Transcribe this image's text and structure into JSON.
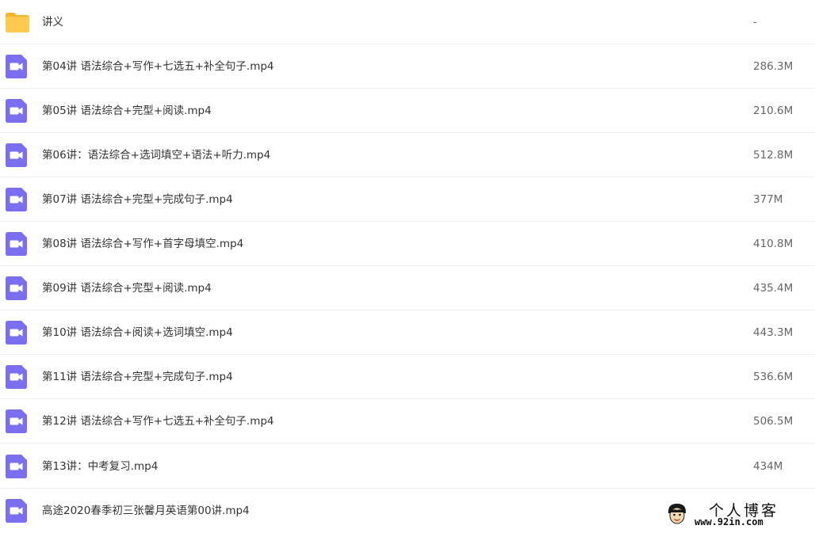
{
  "files": [
    {
      "type": "folder",
      "icon": "folder-icon",
      "name": "讲义",
      "size": "-"
    },
    {
      "type": "video",
      "icon": "video-file-icon",
      "name": "第04讲 语法综合+写作+七选五+补全句子.mp4",
      "size": "286.3M"
    },
    {
      "type": "video",
      "icon": "video-file-icon",
      "name": "第05讲 语法综合+完型+阅读.mp4",
      "size": "210.6M"
    },
    {
      "type": "video",
      "icon": "video-file-icon",
      "name": "第06讲：语法综合+选词填空+语法+听力.mp4",
      "size": "512.8M"
    },
    {
      "type": "video",
      "icon": "video-file-icon",
      "name": "第07讲 语法综合+完型+完成句子.mp4",
      "size": "377M"
    },
    {
      "type": "video",
      "icon": "video-file-icon",
      "name": "第08讲 语法综合+写作+首字母填空.mp4",
      "size": "410.8M"
    },
    {
      "type": "video",
      "icon": "video-file-icon",
      "name": "第09讲 语法综合+完型+阅读.mp4",
      "size": "435.4M"
    },
    {
      "type": "video",
      "icon": "video-file-icon",
      "name": "第10讲 语法综合+阅读+选词填空.mp4",
      "size": "443.3M"
    },
    {
      "type": "video",
      "icon": "video-file-icon",
      "name": "第11讲 语法综合+完型+完成句子.mp4",
      "size": "536.6M"
    },
    {
      "type": "video",
      "icon": "video-file-icon",
      "name": "第12讲 语法综合+写作+七选五+补全句子.mp4",
      "size": "506.5M"
    },
    {
      "type": "video",
      "icon": "video-file-icon",
      "name": "第13讲：中考复习.mp4",
      "size": "434M"
    },
    {
      "type": "video",
      "icon": "video-file-icon",
      "name": "高途2020春季初三张馨月英语第00讲.mp4",
      "size": ""
    }
  ],
  "watermark": {
    "title": "个人博客",
    "url": "www.92in.com"
  },
  "colors": {
    "folder": "#FFC94D",
    "folder_back": "#F5B62E",
    "video": "#7B6FF0",
    "divider": "#F0F0F0"
  }
}
